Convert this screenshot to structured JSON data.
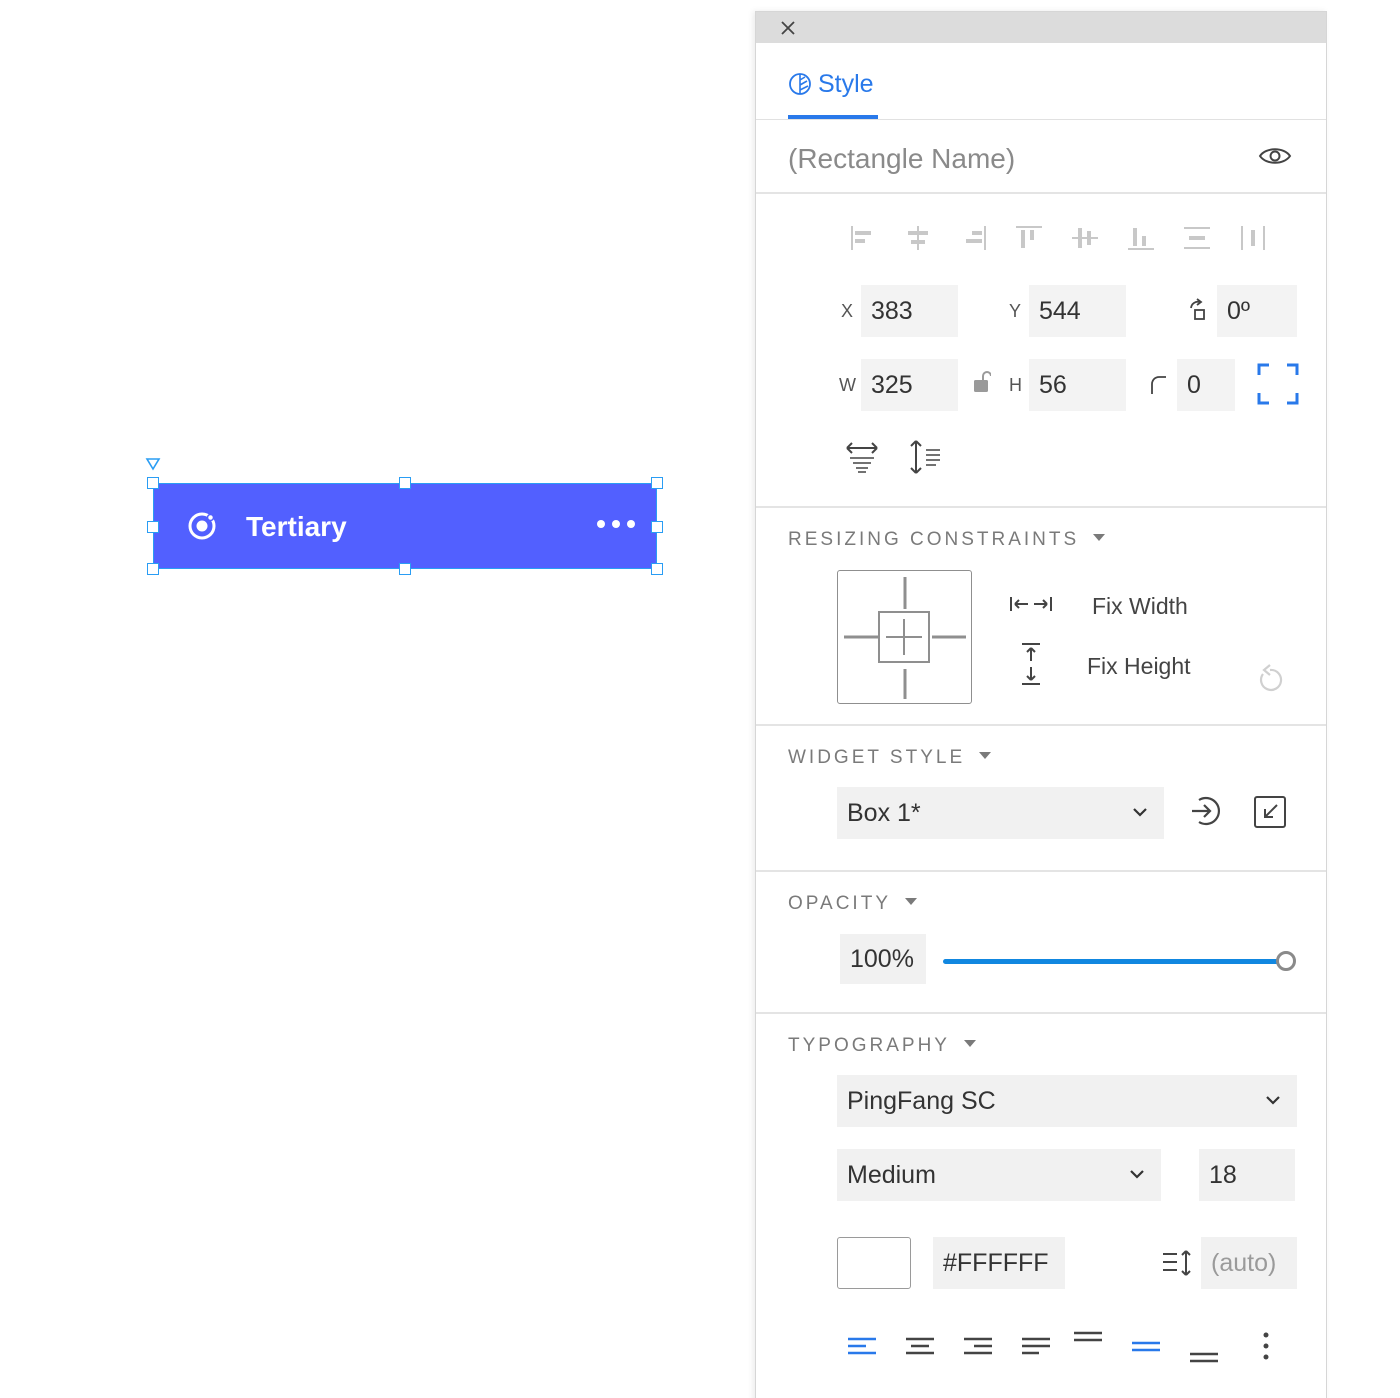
{
  "canvas": {
    "button_label": "Tertiary"
  },
  "panel": {
    "tab_label": "Style",
    "name_placeholder": "(Rectangle Name)",
    "position": {
      "x_label": "X",
      "x_value": "383",
      "y_label": "Y",
      "y_value": "544",
      "rotation_value": "0º",
      "w_label": "W",
      "w_value": "325",
      "h_label": "H",
      "h_value": "56",
      "radius_value": "0"
    },
    "resizing": {
      "header": "RESIZING CONSTRAINTS",
      "fix_width": "Fix Width",
      "fix_height": "Fix Height"
    },
    "widget_style": {
      "header": "WIDGET STYLE",
      "selected": "Box 1*"
    },
    "opacity": {
      "header": "OPACITY",
      "value": "100%",
      "level": 1.0
    },
    "typography": {
      "header": "TYPOGRAPHY",
      "font_family": "PingFang SC",
      "font_weight": "Medium",
      "font_size": "18",
      "color_hex": "#FFFFFF",
      "line_height": "(auto)"
    }
  },
  "colors": {
    "button_fill": "#5260ff",
    "selection": "#2a9df4",
    "accent": "#2979ea",
    "slider": "#1187e0"
  }
}
